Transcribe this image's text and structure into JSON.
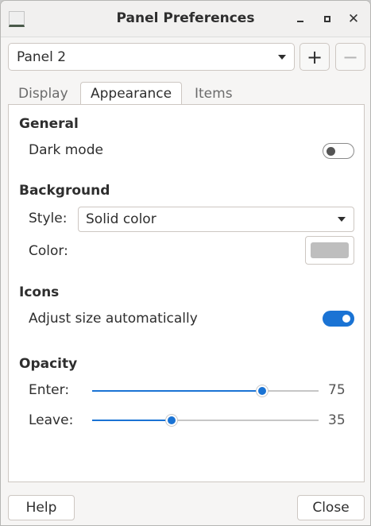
{
  "window": {
    "title": "Panel Preferences"
  },
  "panel_selector": {
    "value": "Panel 2",
    "add_label": "+",
    "remove_label": "−"
  },
  "tabs": [
    {
      "label": "Display",
      "active": false
    },
    {
      "label": "Appearance",
      "active": true
    },
    {
      "label": "Items",
      "active": false
    }
  ],
  "general": {
    "title": "General",
    "dark_mode": {
      "label": "Dark mode",
      "enabled": false
    }
  },
  "background": {
    "title": "Background",
    "style_label": "Style:",
    "style_value": "Solid color",
    "color_label": "Color:",
    "color_value": "#bebebe"
  },
  "icons": {
    "title": "Icons",
    "adjust_size": {
      "label": "Adjust size automatically",
      "enabled": true
    }
  },
  "opacity": {
    "title": "Opacity",
    "enter": {
      "label": "Enter:",
      "value": "75",
      "fraction": 0.75
    },
    "leave": {
      "label": "Leave:",
      "value": "35",
      "fraction": 0.35
    }
  },
  "footer": {
    "help_label": "Help",
    "close_label": "Close"
  },
  "colors": {
    "accent": "#1a73d4"
  }
}
